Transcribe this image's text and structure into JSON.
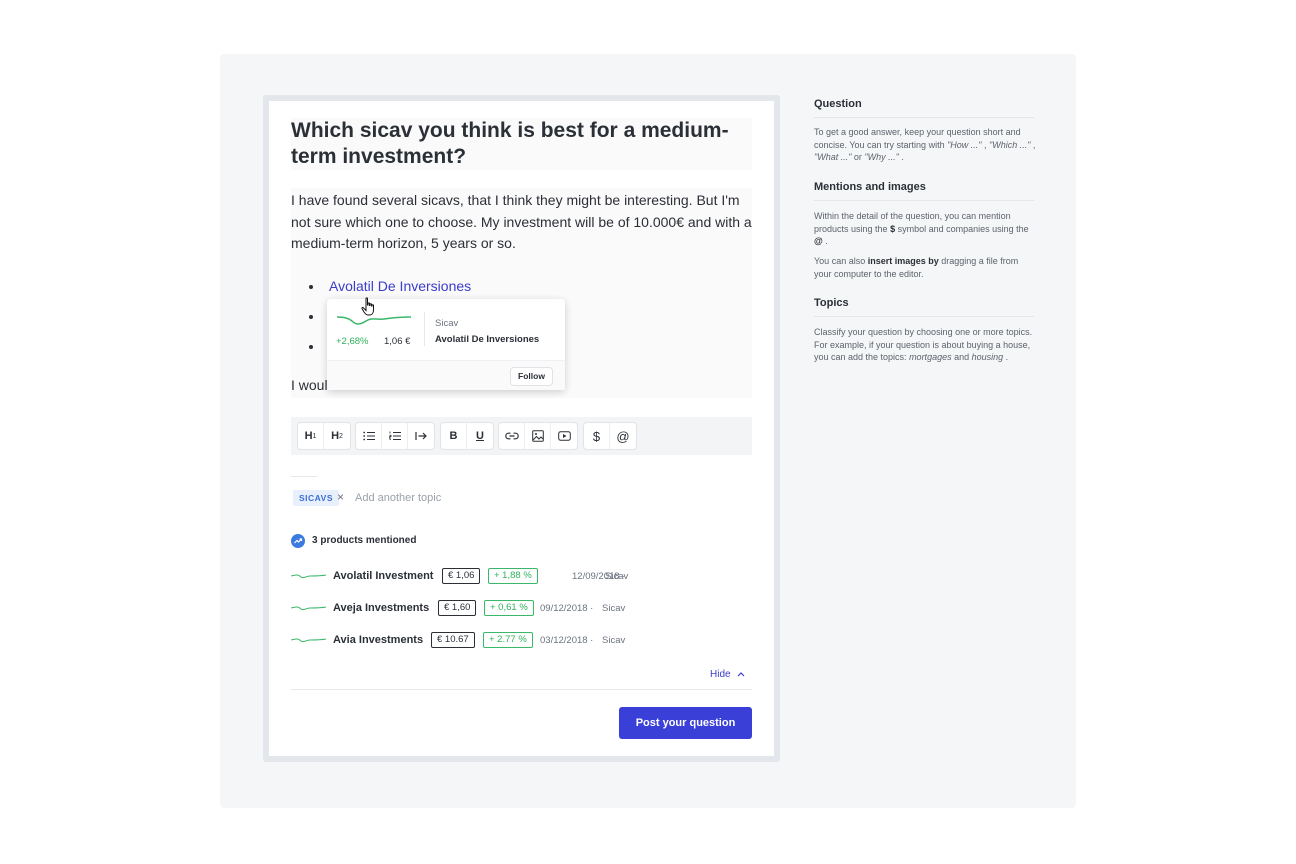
{
  "question": {
    "title": "Which sicav you think is best for a medium-term investment?",
    "body": "I have found several sicavs, that I think they might be interesting. But I'm not sure which one to choose. My investment will be of 10.000€ and with a medium-term horizon, 5 years or so.",
    "bullet_link": "Avolatil De Inversiones",
    "trailing_text": "I would"
  },
  "popover": {
    "change": "+2,68%",
    "price": "1,06 €",
    "type": "Sicav",
    "name": "Avolatil De Inversiones",
    "follow_label": "Follow",
    "spark_color": "#38b868"
  },
  "toolbar": {
    "groups": [
      [
        "heading-1",
        "heading-2"
      ],
      [
        "bulleted-list",
        "numbered-list",
        "indent"
      ],
      [
        "bold",
        "underline"
      ],
      [
        "link",
        "image",
        "video"
      ],
      [
        "dollar-mention",
        "at-mention"
      ]
    ],
    "h1": "H",
    "h1_sub": "1",
    "h2": "H",
    "h2_sub": "2",
    "bold": "B",
    "underline": "U",
    "dollar": "$",
    "at": "@"
  },
  "topics": {
    "chips": [
      "SICAVS"
    ],
    "placeholder": "Add another topic"
  },
  "products": {
    "label": "3 products mentioned",
    "items": [
      {
        "name": "Avolatil Investment",
        "price": "€ 1,06",
        "change": "+ 1,88 %",
        "date": "12/09/2018 ·",
        "type": "Sicav"
      },
      {
        "name": "Aveja Investments",
        "price": "€ 1,60",
        "change": "+ 0,61 %",
        "date": "09/12/2018 ·",
        "type": "Sicav"
      },
      {
        "name": "Avia Investments",
        "price": "€ 10.67",
        "change": "+ 2.77 %",
        "date": "03/12/2018 ·",
        "type": "Sicav"
      }
    ],
    "hide_label": "Hide"
  },
  "submit_label": "Post your question",
  "sidebar": {
    "question": {
      "heading": "Question",
      "text1": "To get a good answer, keep your question short and concise. You can try starting with ",
      "how": "\"How ...\"",
      "which": "\"Which ...\"",
      "what": "\"What ...\"",
      "or": " or ",
      "why": "\"Why ...\""
    },
    "mentions": {
      "heading": "Mentions and images",
      "text1": "Within the detail of the question, you can mention products using the ",
      "dollar": "$",
      "text2": " symbol and companies using the ",
      "at": "@",
      "text3": " .",
      "text4": "You can also ",
      "bold": "insert images by",
      "text5": " dragging a file from your computer to the editor."
    },
    "topics": {
      "heading": "Topics",
      "text1": "Classify your question by choosing one or more topics. For example, if your question is about buying a house, you can add the topics: ",
      "t1": "mortgages",
      "and": " and ",
      "t2": "housing",
      "end": " ."
    }
  },
  "colors": {
    "accent": "#3a3fd8",
    "link": "#3a3ccc",
    "positive": "#2fb15c",
    "chip_bg": "#e8f0fd",
    "chip_text": "#3b6fd6"
  }
}
